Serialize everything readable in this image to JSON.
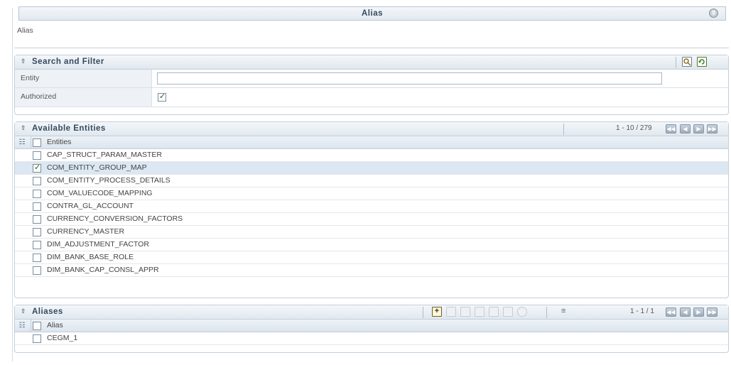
{
  "header": {
    "title": "Alias",
    "subtitle": "Alias",
    "help_icon": "help-icon"
  },
  "search_panel": {
    "title": "Search and Filter",
    "fields": [
      {
        "label": "Entity",
        "value": ""
      },
      {
        "label": "Authorized",
        "checked": true
      }
    ]
  },
  "entities_panel": {
    "title": "Available Entities",
    "pagination": "1 - 10 / 279",
    "column_header": "Entities",
    "rows": [
      {
        "name": "CAP_STRUCT_PARAM_MASTER",
        "checked": false
      },
      {
        "name": "COM_ENTITY_GROUP_MAP",
        "checked": true
      },
      {
        "name": "COM_ENTITY_PROCESS_DETAILS",
        "checked": false
      },
      {
        "name": "COM_VALUECODE_MAPPING",
        "checked": false
      },
      {
        "name": "CONTRA_GL_ACCOUNT",
        "checked": false
      },
      {
        "name": "CURRENCY_CONVERSION_FACTORS",
        "checked": false
      },
      {
        "name": "CURRENCY_MASTER",
        "checked": false
      },
      {
        "name": "DIM_ADJUSTMENT_FACTOR",
        "checked": false
      },
      {
        "name": "DIM_BANK_BASE_ROLE",
        "checked": false
      },
      {
        "name": "DIM_BANK_CAP_CONSL_APPR",
        "checked": false
      }
    ]
  },
  "aliases_panel": {
    "title": "Aliases",
    "pagination": "1 - 1 / 1",
    "column_header": "Alias",
    "rows": [
      {
        "name": "CEGM_1",
        "checked": false
      }
    ]
  }
}
